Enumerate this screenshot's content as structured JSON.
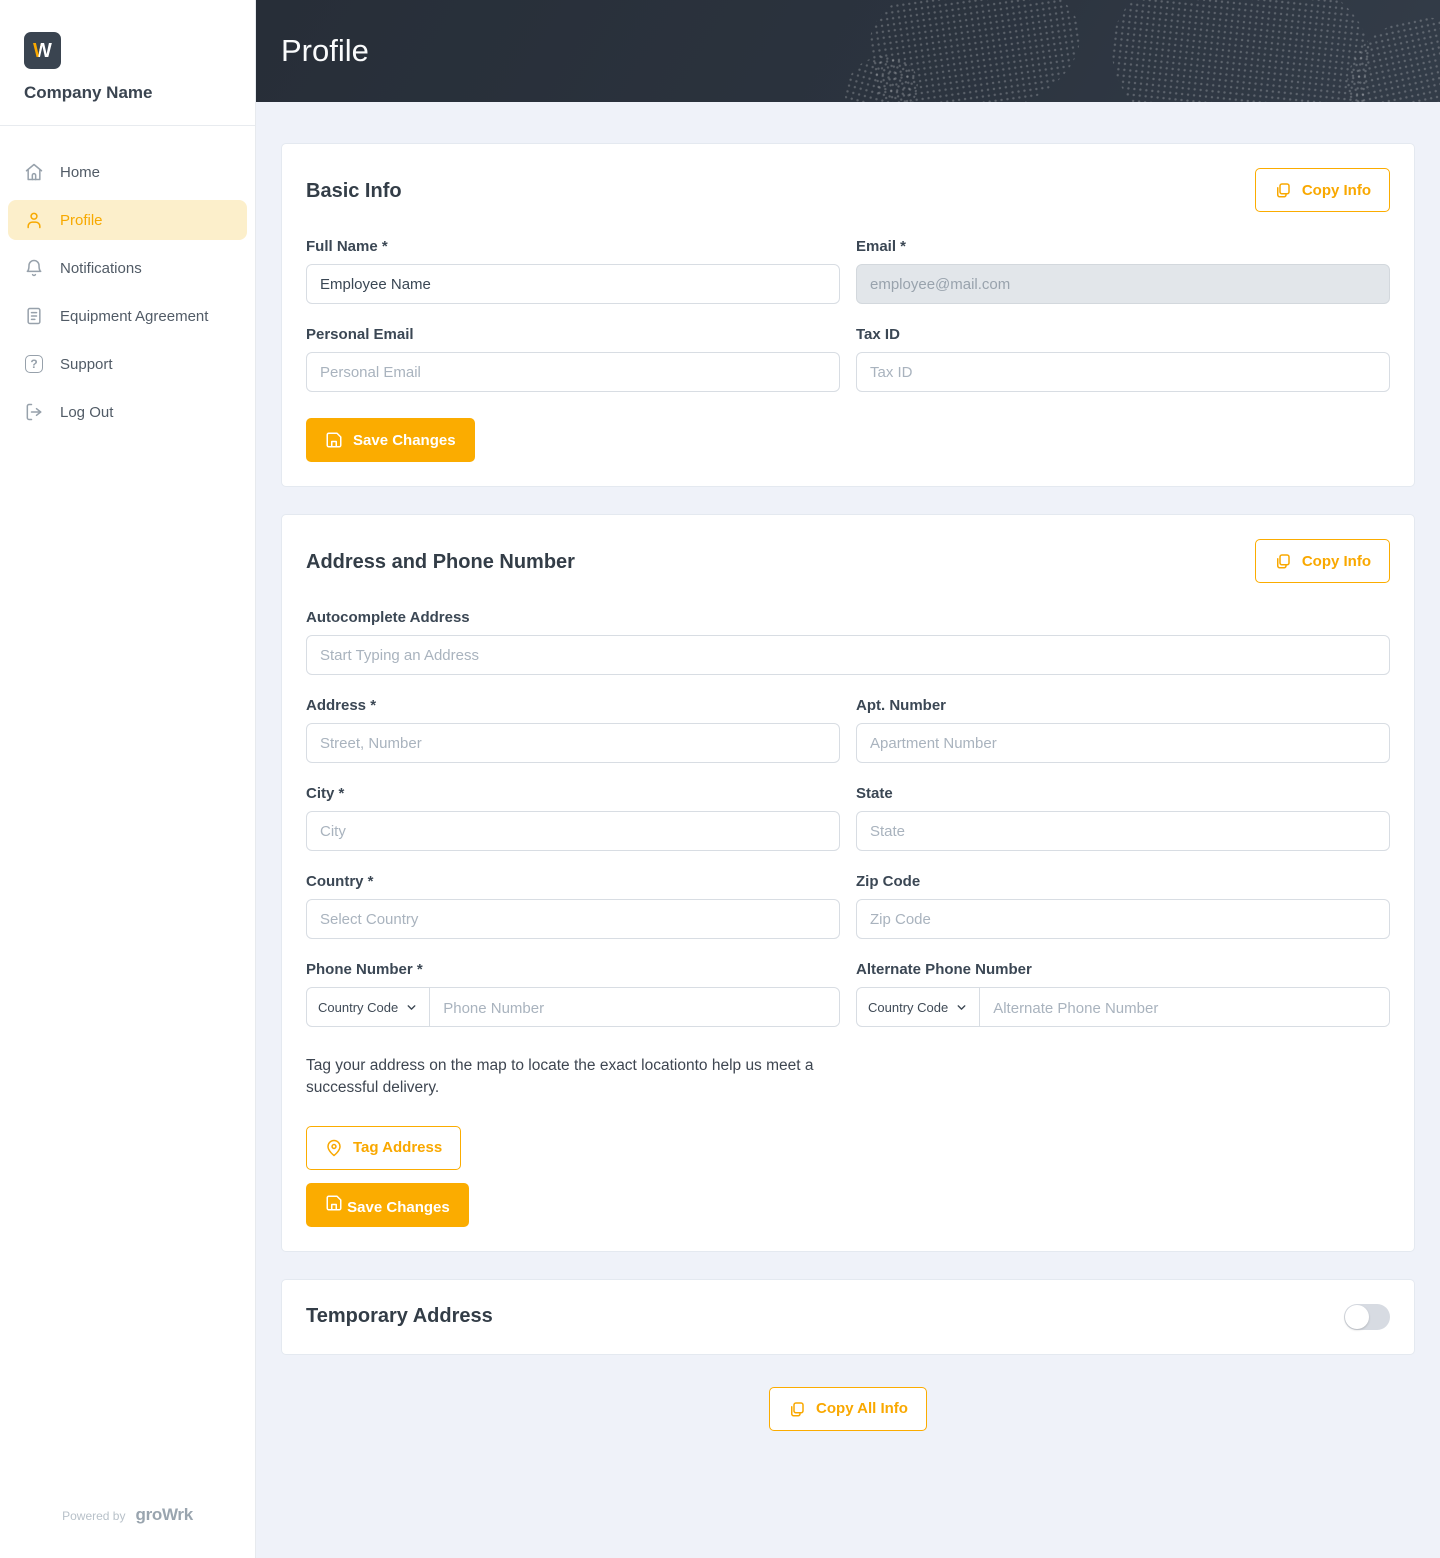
{
  "sidebar": {
    "logo_letter": "W",
    "company_name": "Company Name",
    "items": [
      {
        "label": "Home",
        "icon": "home-icon",
        "active": false
      },
      {
        "label": "Profile",
        "icon": "user-icon",
        "active": true
      },
      {
        "label": "Notifications",
        "icon": "bell-icon",
        "active": false
      },
      {
        "label": "Equipment Agreement",
        "icon": "document-icon",
        "active": false
      },
      {
        "label": "Support",
        "icon": "question-icon",
        "active": false
      },
      {
        "label": "Log Out",
        "icon": "logout-icon",
        "active": false
      }
    ],
    "powered_by": "Powered by",
    "brand": "groWrk"
  },
  "header": {
    "title": "Profile"
  },
  "basic_info": {
    "title": "Basic Info",
    "copy_button": "Copy Info",
    "save_button": "Save Changes",
    "fields": {
      "full_name": {
        "label": "Full Name *",
        "value": "Employee Name"
      },
      "email": {
        "label": "Email *",
        "value": "employee@mail.com"
      },
      "personal_email": {
        "label": "Personal Email",
        "placeholder": "Personal Email"
      },
      "tax_id": {
        "label": "Tax ID",
        "placeholder": "Tax ID"
      }
    }
  },
  "address": {
    "title": "Address and Phone Number",
    "copy_button": "Copy Info",
    "save_button": "Save Changes",
    "tag_button": "Tag Address",
    "tag_note": "Tag your address on the map to locate the exact locationto help us meet a successful delivery.",
    "fields": {
      "autocomplete": {
        "label": "Autocomplete Address",
        "placeholder": "Start Typing an Address"
      },
      "address": {
        "label": "Address *",
        "placeholder": "Street, Number"
      },
      "apt": {
        "label": "Apt. Number",
        "placeholder": "Apartment Number"
      },
      "city": {
        "label": "City *",
        "placeholder": "City"
      },
      "state": {
        "label": "State",
        "placeholder": "State"
      },
      "country": {
        "label": "Country *",
        "placeholder": "Select Country"
      },
      "zip": {
        "label": "Zip Code",
        "placeholder": "Zip Code"
      },
      "phone": {
        "label": "Phone Number *",
        "country_code": "Country Code",
        "placeholder": "Phone Number"
      },
      "alt_phone": {
        "label": "Alternate Phone Number",
        "country_code": "Country Code",
        "placeholder": "Alternate Phone Number"
      }
    }
  },
  "temporary_address": {
    "title": "Temporary Address",
    "toggle_on": false
  },
  "footer": {
    "copy_all_button": "Copy All Info"
  },
  "colors": {
    "accent": "#FBAC00",
    "accent_text": "#F9A800",
    "active_item_bg": "#FCEFCB",
    "header_bg": "#2A313C",
    "page_bg": "#EFF2F9",
    "disabled_input_bg": "#E2E6EA",
    "toggle_track": "#D7DBE2"
  }
}
